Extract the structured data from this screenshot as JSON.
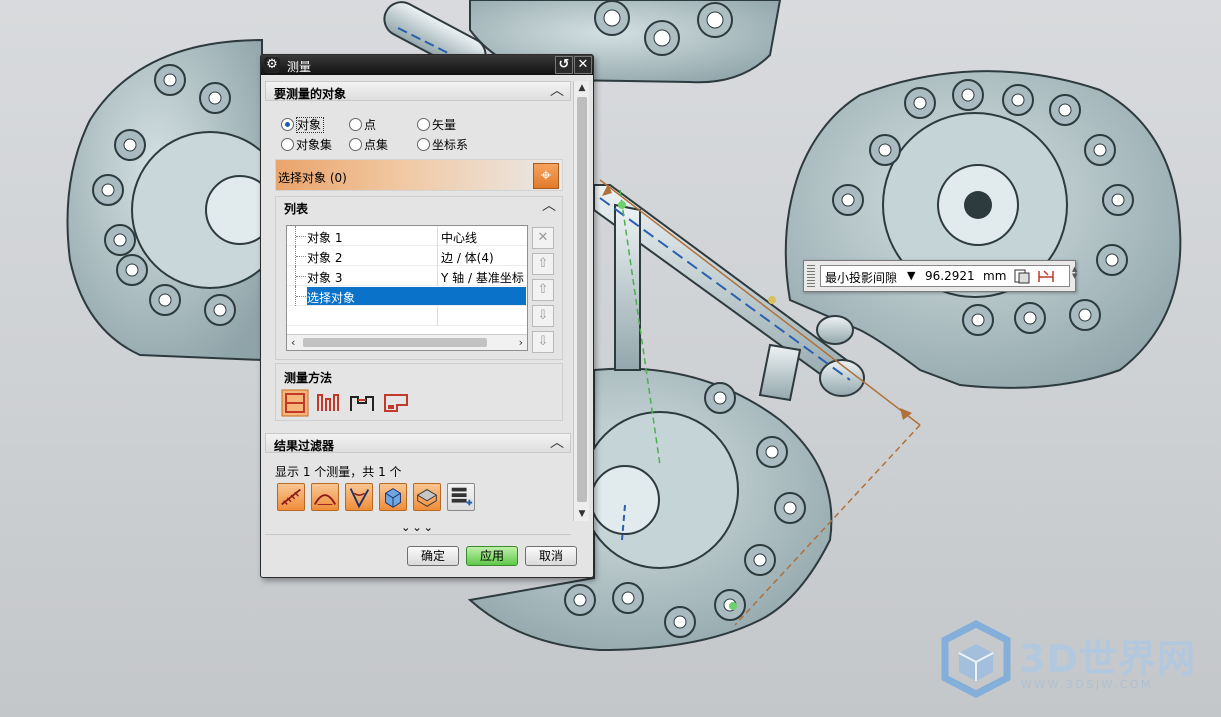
{
  "dialog": {
    "title": "测量",
    "section_objects": {
      "header": "要测量的对象",
      "radios": [
        {
          "label": "对象",
          "selected": true
        },
        {
          "label": "点",
          "selected": false
        },
        {
          "label": "矢量",
          "selected": false
        },
        {
          "label": "对象集",
          "selected": false
        },
        {
          "label": "点集",
          "selected": false
        },
        {
          "label": "坐标系",
          "selected": false
        }
      ],
      "select_label": "选择对象 (0)"
    },
    "list": {
      "header": "列表",
      "rows": [
        {
          "name": "对象 1",
          "type": "中心线"
        },
        {
          "name": "对象 2",
          "type": "边 / 体(4)"
        },
        {
          "name": "对象 3",
          "type": "Y 轴 / 基准坐标"
        },
        {
          "name": "选择对象",
          "type": "",
          "selected": true
        }
      ]
    },
    "method": {
      "header": "测量方法",
      "icons": [
        "minimum-distance-icon",
        "projected-distance-icon",
        "profile-clearance-icon",
        "max-projected-distance-icon"
      ]
    },
    "result_filter": {
      "header": "结果过滤器",
      "summary": "显示 1 个测量，共 1 个",
      "icons": [
        "distance-filter-icon",
        "angle-filter-icon",
        "arc-filter-icon",
        "solid-filter-icon",
        "face-filter-icon",
        "list-add-icon"
      ]
    },
    "more": "⌄⌄⌄",
    "buttons": {
      "ok": "确定",
      "apply": "应用",
      "cancel": "取消"
    }
  },
  "readout": {
    "type": "最小投影间隙",
    "value": "96.2921",
    "unit": "mm"
  },
  "watermark": {
    "title": "3D世界网",
    "url": "WWW.3DSJW.COM"
  },
  "colors": {
    "accent_orange": "#e8893a",
    "selection_blue": "#0a72c9",
    "apply_green": "#5fc84a",
    "part_gray": "#b6c7cb"
  }
}
